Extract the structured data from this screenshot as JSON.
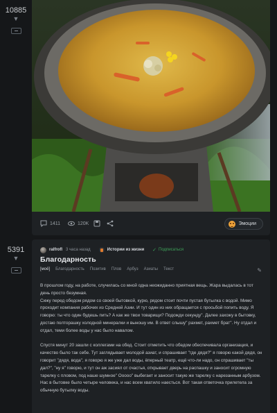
{
  "post1": {
    "rating": "10885",
    "comments": "1411",
    "views": "120K",
    "emotions_label": "Эмоции",
    "image_description_icon": "photo-plov-kazan"
  },
  "post2": {
    "rating": "5391",
    "author": "ralfrofl",
    "time": "3 часа назад",
    "community": "Истории из жизни",
    "subscribed": "Подписаться",
    "title": "Благодарность",
    "tags": [
      "[моё]",
      "Благодарность",
      "Позитив",
      "Плов",
      "Арбуз",
      "Азиаты",
      "Текст"
    ],
    "paragraphs": [
      "В прошлом году, на работе, случилась со мной одна неожиданно приятная вещь. Жара выдалась в тот день просто безумная.\nСижу перед обедом рядом со своей бытовкой, курю, рядом стоит почти пустая бутылка с водой. Мимо проходит компания рабочих из Средней Азии. И тут один из них обращается с просьбой попить воду. Я говорю: ты что один будешь пить? А как же твои товарищи? Подожди секунду\". Далее захожу в бытовку, достаю полторашку холодной минералки и выношу им. В ответ слышу\" рахмет, рахмет брат\". Ну отдал и отдал, теми более воды у нас было навалом.",
      "Спустя минут 20 зашли с коллегами на обед. Стоит отметить что обедом обеспечивала организация, и качество было так себе. Тут заглядывает молодой азиат, и спрашивает \"где дядя?\" я говорю какой дядя, он говорит \"дядя, вода\", я говорю я же уже дал воды, ёперный театр, ещё что-ли надо, он спрашивает \"ты дал?\", \"ну я\" говорю, и тут он аж засиял от счастья, открывает дверь на распашку и заносит огромную тарелку с пловом, под наше шумное\" Ооооо\" выбегает и заносит такую же тарелку с нарезанным арбузом. Нас в бытовке было четыре человека, и нас всем хватило наесться. Вот такая ответочка прилетела за обычную бутылку воды."
    ]
  },
  "colors": {
    "background": "#151719",
    "card": "#1e2124",
    "accent_green": "#3fa45a",
    "emotion": "#f0a43a"
  }
}
